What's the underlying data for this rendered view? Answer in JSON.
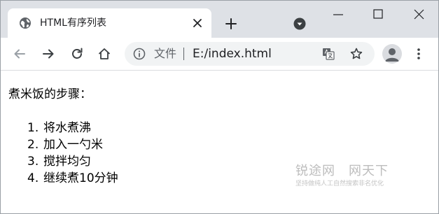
{
  "tab": {
    "title": "HTML有序列表",
    "favicon": "globe-icon"
  },
  "address_bar": {
    "chip_label": "文件",
    "url": "E:/index.html"
  },
  "icons": {
    "back": "back-arrow-icon",
    "forward": "forward-arrow-icon",
    "reload": "reload-icon",
    "home": "home-icon",
    "translate": "translate-icon",
    "bookmark": "star-icon",
    "profile": "avatar-icon",
    "menu": "kebab-menu-icon"
  },
  "page": {
    "intro": "煮米饭的步骤：",
    "steps": [
      {
        "number": "1.",
        "text": "将水煮沸"
      },
      {
        "number": "2.",
        "text": "加入一勺米"
      },
      {
        "number": "3.",
        "text": "搅拌均匀"
      },
      {
        "number": "4.",
        "text": "继续煮10分钟"
      }
    ]
  },
  "watermark": {
    "main": "锐途网　网天下",
    "sub": "坚持做纯人工自然搜索非名优化"
  },
  "colors": {
    "tabstrip": "#dee1e6",
    "omnibox": "#f1f3f4",
    "icon": "#5f6368",
    "text": "#202124"
  }
}
